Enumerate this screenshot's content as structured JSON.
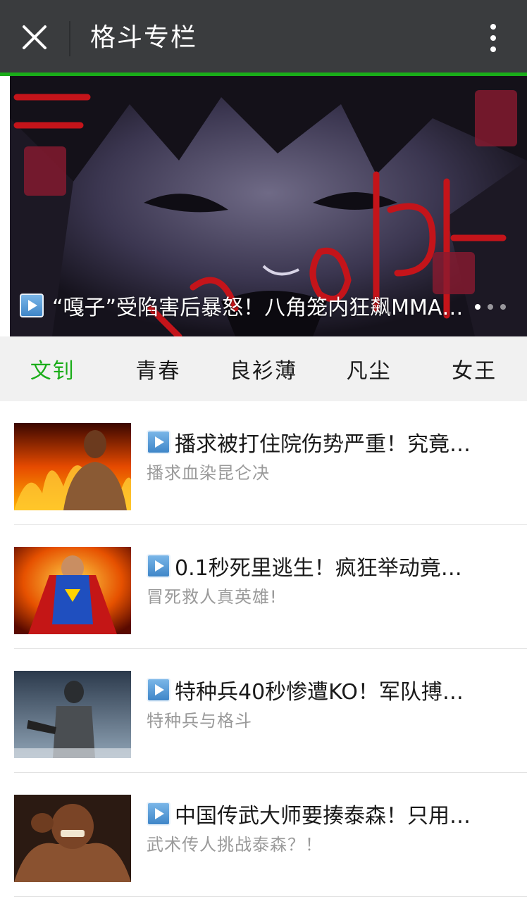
{
  "header": {
    "title": "格斗专栏",
    "close_icon": "close-icon",
    "more_icon": "more-vertical-icon",
    "accent_color": "#1aad19"
  },
  "banner": {
    "caption": "“嘎子”受陷害后暴怒！八角笼内狂飙MMA…",
    "icon": "play-icon",
    "page_count": 3,
    "active_page": 1
  },
  "tabs": [
    {
      "label": "文钊",
      "active": true
    },
    {
      "label": "青春",
      "active": false
    },
    {
      "label": "良衫薄",
      "active": false
    },
    {
      "label": "凡尘",
      "active": false
    },
    {
      "label": "女王",
      "active": false
    }
  ],
  "articles": [
    {
      "title": "播求被打住院伤势严重！究竟…",
      "subtitle": "播求血染昆仑决",
      "icon": "play-icon"
    },
    {
      "title": "0.1秒死里逃生！疯狂举动竟…",
      "subtitle": "冒死救人真英雄!",
      "icon": "play-icon"
    },
    {
      "title": "特种兵40秒惨遭KO！军队搏…",
      "subtitle": "特种兵与格斗",
      "icon": "play-icon"
    },
    {
      "title": "中国传武大师要揍泰森！只用…",
      "subtitle": "武术传人挑战泰森？！",
      "icon": "play-icon"
    }
  ]
}
